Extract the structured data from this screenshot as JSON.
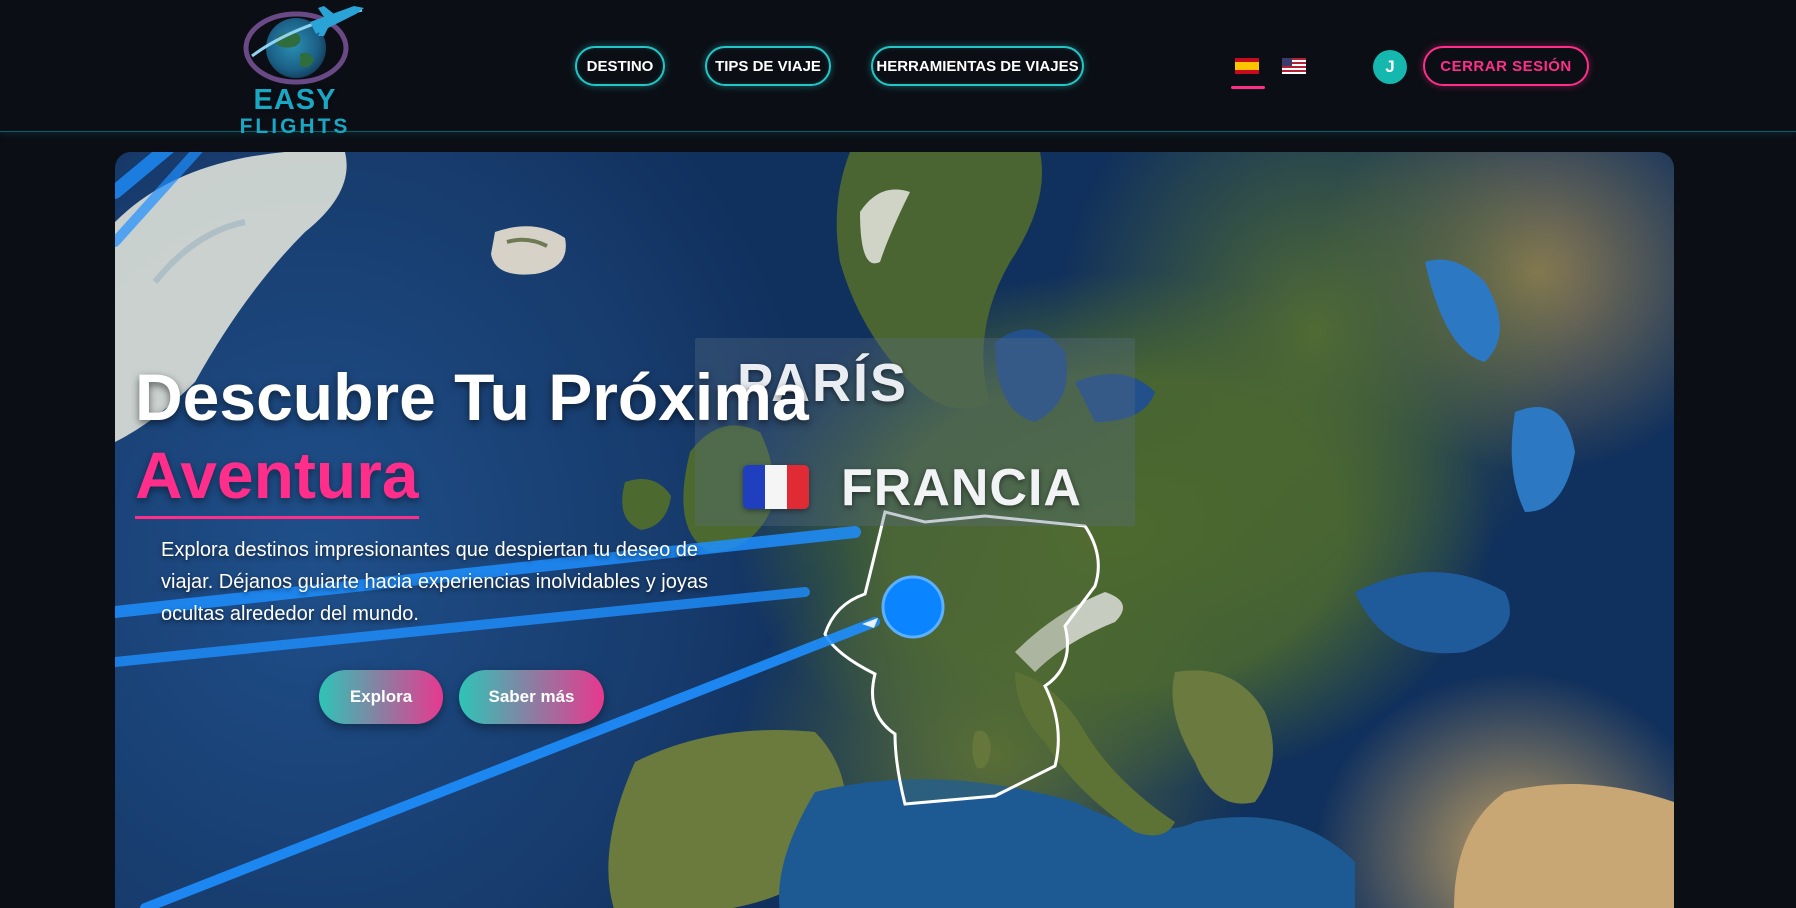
{
  "header": {
    "logo": {
      "line1": "EASY",
      "line2": "FLIGHTS"
    },
    "nav": [
      {
        "label": "DESTINO"
      },
      {
        "label": "TIPS DE VIAJE"
      },
      {
        "label": "HERRAMIENTAS DE VIAJES"
      }
    ],
    "languages": [
      {
        "code": "es",
        "icon": "spain-flag-icon",
        "selected": true
      },
      {
        "code": "en",
        "icon": "us-flag-icon",
        "selected": false
      }
    ],
    "user": {
      "initial": "J"
    },
    "logout_label": "CERRAR SESIÓN"
  },
  "hero": {
    "map_overlay": {
      "city": "PARÍS",
      "country": "FRANCIA",
      "country_flag_icon": "france-flag-icon"
    },
    "title": "Descubre Tu Próxima",
    "title_accent": "Aventura",
    "description": "Explora destinos impresionantes que despiertan tu deseo de viajar. Déjanos guiarte hacia experiencias inolvidables y joyas ocultas alrededor del mundo.",
    "buttons": [
      {
        "label": "Explora"
      },
      {
        "label": "Saber más"
      }
    ]
  },
  "colors": {
    "background": "#0b0e15",
    "accent_teal": "#23c6c6",
    "accent_pink": "#ff2e8a",
    "logo_blue": "#1aa7c4",
    "button_gradient_start": "#2ec4b6",
    "button_gradient_end": "#e8388e"
  }
}
